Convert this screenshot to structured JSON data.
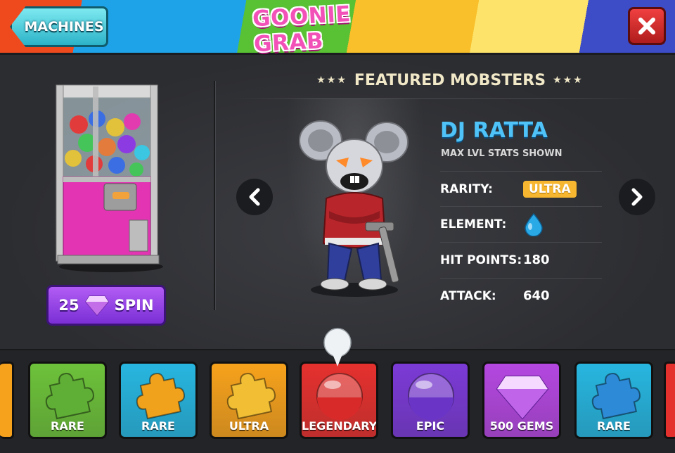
{
  "header": {
    "machines_label": "MACHINES",
    "title": "GOONIE GRAB",
    "close_icon": "close-icon"
  },
  "left_panel": {
    "spin_cost": "25",
    "spin_label": "SPIN",
    "gem_icon": "gem-icon"
  },
  "featured": {
    "stars_left": "★★★",
    "title": "FEATURED MOBSTERS",
    "stars_right": "★★★"
  },
  "mobster": {
    "name": "DJ RATTA",
    "subtitle": "MAX LVL STATS SHOWN",
    "stats": [
      {
        "label": "RARITY:",
        "value": "ULTRA"
      },
      {
        "label": "ELEMENT:",
        "value": "",
        "icon": "water-drop-icon"
      },
      {
        "label": "HIT POINTS:",
        "value": "180"
      },
      {
        "label": "ATTACK:",
        "value": "640"
      }
    ]
  },
  "rewards": [
    {
      "label": "RARE",
      "color": "#6dc23a",
      "icon": "puzzle-piece-icon"
    },
    {
      "label": "RARE",
      "color": "#27b6e0",
      "icon": "puzzle-piece-icon"
    },
    {
      "label": "ULTRA",
      "color": "#f7a21c",
      "icon": "puzzle-piece-icon"
    },
    {
      "label": "LEGENDARY",
      "color": "#e5312e",
      "icon": "capsule-icon"
    },
    {
      "label": "EPIC",
      "color": "#7b3ad6",
      "icon": "capsule-icon"
    },
    {
      "label": "500 GEMS",
      "color": "#b447e0",
      "icon": "gem-icon"
    },
    {
      "label": "RARE",
      "color": "#27b6e0",
      "icon": "puzzle-piece-icon"
    }
  ],
  "colors": {
    "accent_blue": "#4fc3f7",
    "spin_purple": "#8a3be0",
    "close_red": "#d42a2a"
  }
}
